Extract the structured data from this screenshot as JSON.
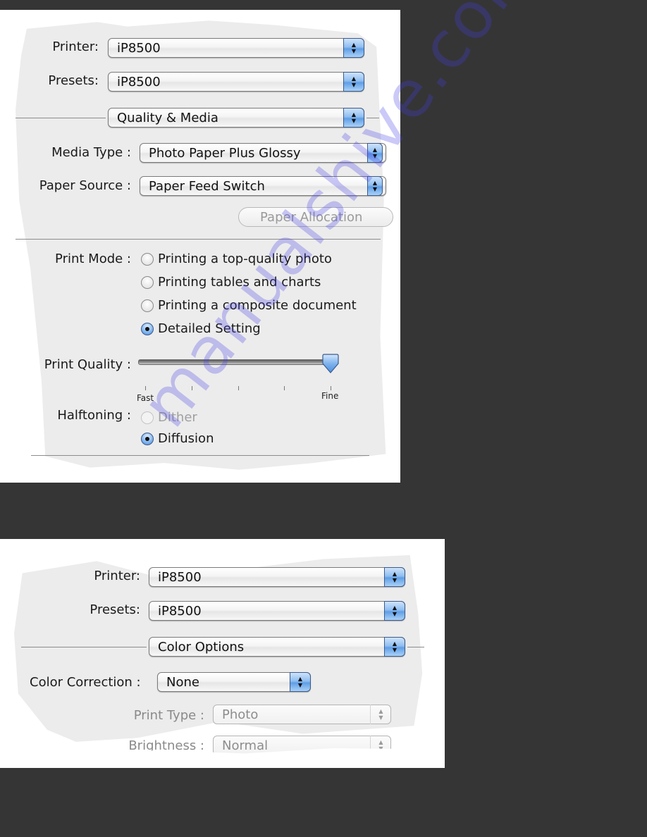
{
  "panel1": {
    "printer": {
      "label": "Printer:",
      "value": "iP8500"
    },
    "presets": {
      "label": "Presets:",
      "value": "iP8500"
    },
    "section_popup": {
      "value": "Quality & Media"
    },
    "media_type": {
      "label": "Media Type :",
      "value": "Photo Paper Plus Glossy"
    },
    "paper_source": {
      "label": "Paper Source :",
      "value": "Paper Feed Switch"
    },
    "paper_allocation_button": {
      "label": "Paper Allocation",
      "enabled": false
    },
    "print_mode": {
      "label": "Print Mode :",
      "options": [
        {
          "label": "Printing a top-quality photo",
          "checked": false
        },
        {
          "label": "Printing tables and charts",
          "checked": false
        },
        {
          "label": "Printing a composite document",
          "checked": false
        },
        {
          "label": "Detailed Setting",
          "checked": true
        }
      ]
    },
    "print_quality": {
      "label": "Print Quality :",
      "min_label": "Fast",
      "max_label": "Fine",
      "positions": 5,
      "value_position": 5
    },
    "halftoning": {
      "label": "Halftoning :",
      "options": [
        {
          "label": "Dither",
          "checked": false,
          "enabled": false
        },
        {
          "label": "Diffusion",
          "checked": true,
          "enabled": true
        }
      ]
    }
  },
  "panel2": {
    "printer": {
      "label": "Printer:",
      "value": "iP8500"
    },
    "presets": {
      "label": "Presets:",
      "value": "iP8500"
    },
    "section_popup": {
      "value": "Color Options"
    },
    "color_correction": {
      "label": "Color Correction :",
      "value": "None"
    },
    "print_type": {
      "label": "Print Type :",
      "value": "Photo",
      "enabled": false
    },
    "brightness": {
      "label": "Brightness :",
      "value": "Normal",
      "enabled": false
    }
  },
  "icons": {
    "popup_arrows": "up-down-arrows-icon",
    "up_glyph": "▲",
    "down_glyph": "▼"
  },
  "colors": {
    "background": "#353535",
    "panel": "#ececec",
    "accent_blue": "#6fa8ea",
    "watermark": "#5a4de6"
  },
  "watermark": {
    "text": "manualshive.com"
  }
}
